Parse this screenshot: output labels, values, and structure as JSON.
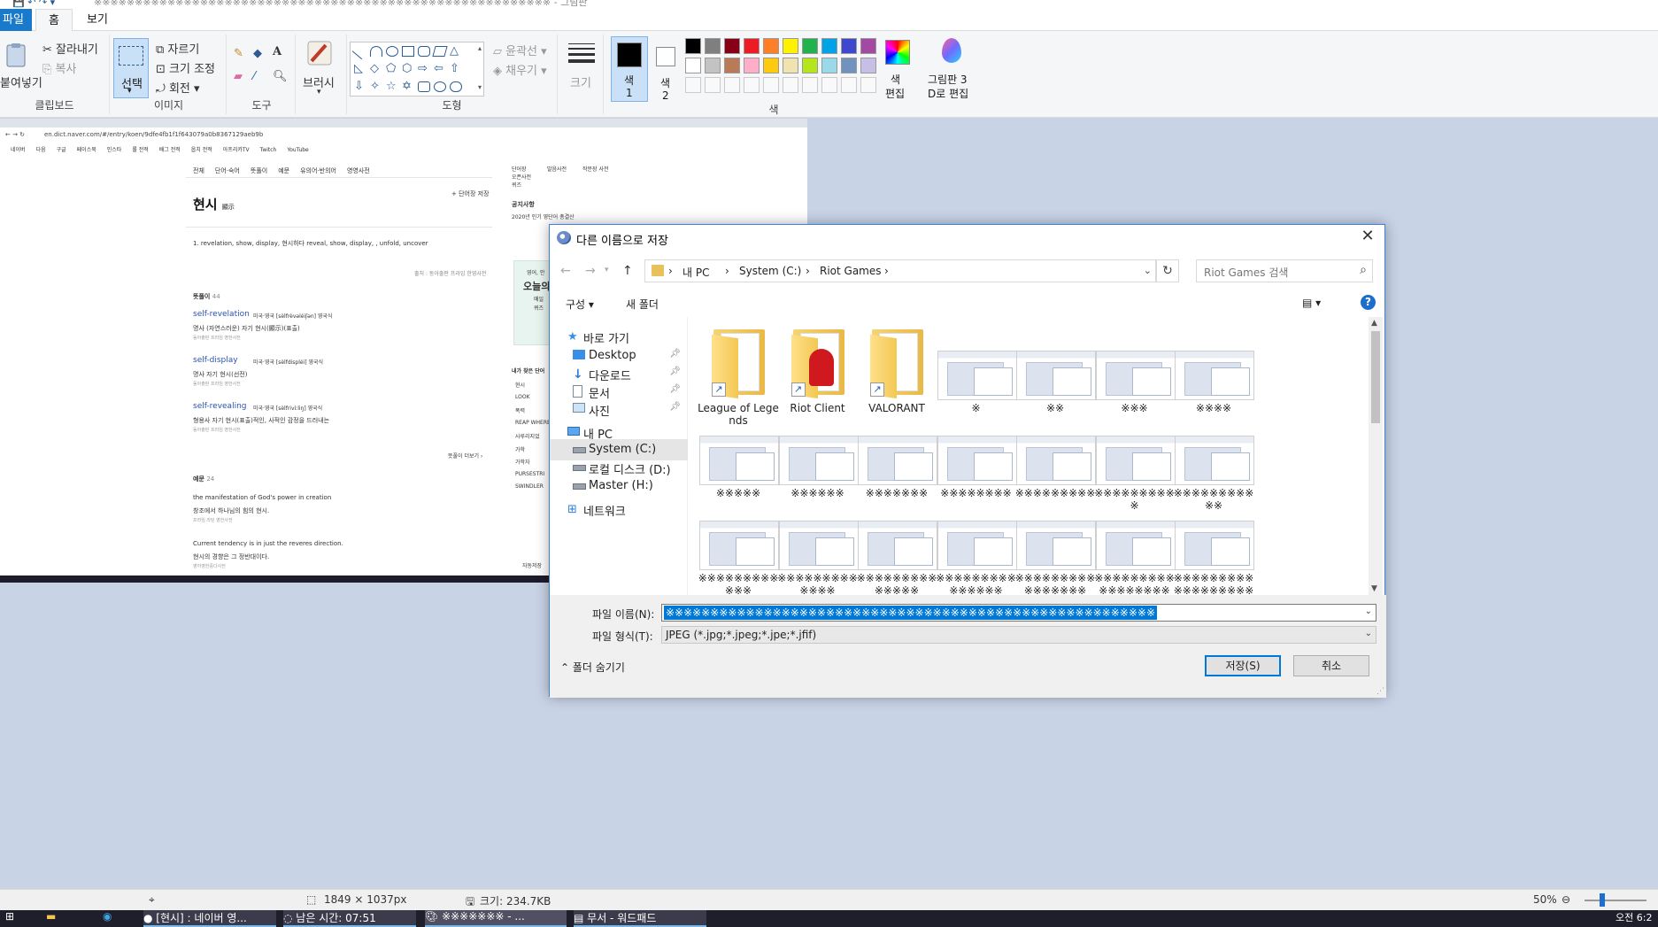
{
  "paint": {
    "title": "※※※※※※※※※※※※※※※※※※※※※※※※※※※※※※※※※※※※※※※※※※※※※※※※※※※※※※※※ - 그림판",
    "tabs": [
      "파일",
      "홈",
      "보기"
    ],
    "clipboard": {
      "paste": "붙여넣기",
      "cut": "잘라내기",
      "copy": "복사",
      "label": "클립보드"
    },
    "image": {
      "select": "선택",
      "crop": "자르기",
      "resize": "크기 조정",
      "rotate": "회전",
      "label": "이미지"
    },
    "tools": {
      "label": "도구"
    },
    "brushes": "브러시",
    "shapes": {
      "outline": "윤곽선",
      "fill": "채우기",
      "label": "도형"
    },
    "size": "크기",
    "color1": {
      "label": "색",
      "num": "1",
      "value": "#000000"
    },
    "color2": {
      "label": "색",
      "num": "2",
      "value": "#ffffff"
    },
    "colors_label": "색",
    "edit_colors": [
      "색",
      "편집"
    ],
    "paint3d": [
      "그림판 3",
      "D로 편집"
    ],
    "palette_row1": [
      "#000000",
      "#7f7f7f",
      "#880015",
      "#ed1c24",
      "#ff7f27",
      "#fff200",
      "#22b14c",
      "#00a2e8",
      "#3f48cc",
      "#a349a4"
    ],
    "palette_row2": [
      "#ffffff",
      "#c3c3c3",
      "#b97a57",
      "#ffaec9",
      "#ffc90e",
      "#efe4b0",
      "#b5e61d",
      "#99d9ea",
      "#7092be",
      "#c8bfe7"
    ]
  },
  "canvas": {
    "url": "en.dict.naver.com/#/entry/koen/9dfe4fb1f1f643079a0b8367129aeb9b",
    "bookmarks": [
      "네이버",
      "다음",
      "구글",
      "페이스북",
      "인스타",
      "롤 전적",
      "배그 전적",
      "옵치 전적",
      "아프리카TV",
      "Twitch",
      "YouTube"
    ],
    "nav_tabs": [
      "전체",
      "단어·숙어",
      "뜻풀이",
      "예문",
      "유의어·반의어",
      "영영사전"
    ],
    "word": "현시",
    "word_hanja": "顯示",
    "add_wordbook": "+ 단어장 저장",
    "meaning": "1.  revelation, show, display, 현시하다 reveal, show, display, , unfold, uncover",
    "source": "출처 : 동아출판 프라임 한영사전",
    "section_meanings": "뜻풀이",
    "section_meanings_count": "44",
    "entries": [
      {
        "word": "self-revelation",
        "pron": "미국·영국 [sèlfrèvəléiʃən]  영국식",
        "ko": "명사 (자연스러운) 자기 현시(顯示)(표출)",
        "src": "동아출판 프라임 영한사전"
      },
      {
        "word": "self-display",
        "pron": "미국·영국 [sèlfdispléi]  영국식",
        "ko": "명사 자기 현시(선전)",
        "src": "동아출판 프라임 영한사전"
      },
      {
        "word": "self-revealing",
        "pron": "미국·영국 [sèlfrivíːliŋ]  영국식",
        "ko": "형용사 자기 현시(표출)적인, 사적인 감정을 드러내는",
        "src": "동아출판 프라임 영한사전"
      }
    ],
    "more_meanings": "뜻풀이 더보기 ›",
    "section_examples": "예문",
    "section_examples_count": "24",
    "examples": [
      {
        "en": "the manifestation of God's power in creation",
        "ko": "창조에서 하나님의 힘의 현시.",
        "src": "프라임 라틴 영한사전"
      },
      {
        "en": "Current tendency is in just the reveres direction.",
        "ko": "현시의 경향은 그 정반대이다.",
        "src": "영어영한중다사전"
      }
    ],
    "side_tabs": [
      "단어장",
      "발음사전",
      "작문장 사전",
      "오픈사전",
      "퀴즈"
    ],
    "notice": "공지사항",
    "notice_text": "2020년 인기 영단어 총결산",
    "green_title": "영어, 안",
    "green_sub": "오늘의",
    "green_small": [
      "매일",
      "퀴즈"
    ],
    "recent_title": "내가 찾은 단어",
    "recent": [
      "현시",
      "LOOK",
      "폭력",
      "REAP WHERE",
      "사루리지었",
      "가학",
      "가학자",
      "PURSESTRI",
      "SWINDLER"
    ],
    "autocomplete": "자동저장"
  },
  "dialog": {
    "title": "다른 이름으로 저장",
    "path": [
      "내 PC",
      "System (C:)",
      "Riot Games"
    ],
    "search_placeholder": "Riot Games 검색",
    "organize": "구성 ▾",
    "new_folder": "새 폴더",
    "nav": [
      {
        "label": "바로 가기",
        "icon": "star-icon",
        "pin": false
      },
      {
        "label": "Desktop",
        "icon": "desktop-icon",
        "pin": true
      },
      {
        "label": "다운로드",
        "icon": "download-icon",
        "pin": true
      },
      {
        "label": "문서",
        "icon": "document-icon",
        "pin": true
      },
      {
        "label": "사진",
        "icon": "picture-icon",
        "pin": true
      },
      {
        "label": "내 PC",
        "icon": "pc-icon",
        "pin": false
      },
      {
        "label": "System (C:)",
        "icon": "drive-icon",
        "pin": false
      },
      {
        "label": "로컬 디스크 (D:)",
        "icon": "drive-icon",
        "pin": false
      },
      {
        "label": "Master (H:)",
        "icon": "drive-icon",
        "pin": false
      },
      {
        "label": "네트워크",
        "icon": "network-icon",
        "pin": false
      }
    ],
    "files": [
      {
        "name": "League of Legends",
        "kind": "folder"
      },
      {
        "name": "Riot Client",
        "kind": "riot"
      },
      {
        "name": "VALORANT",
        "kind": "folder"
      },
      {
        "name": "※",
        "kind": "img"
      },
      {
        "name": "※※",
        "kind": "img"
      },
      {
        "name": "※※※",
        "kind": "img"
      },
      {
        "name": "※※※※",
        "kind": "img"
      },
      {
        "name": "※※※※※",
        "kind": "img"
      },
      {
        "name": "※※※※※※",
        "kind": "img"
      },
      {
        "name": "※※※※※※※",
        "kind": "img"
      },
      {
        "name": "※※※※※※※※",
        "kind": "img"
      },
      {
        "name": "※※※※※※※※※",
        "kind": "img"
      },
      {
        "name": "※※※※※※※※※※",
        "kind": "img"
      },
      {
        "name": "※※※※※※※※※※※",
        "kind": "img"
      },
      {
        "name": "※※※※※※※※※※※※",
        "kind": "img"
      },
      {
        "name": "※※※※※※※※※※※※※",
        "kind": "img"
      },
      {
        "name": "※※※※※※※※※※※※※※",
        "kind": "img"
      },
      {
        "name": "※※※※※※※※※※※※※※※",
        "kind": "img"
      },
      {
        "name": "※※※※※※※※※※※※※※※※",
        "kind": "img"
      },
      {
        "name": "※※※※※※※※※※※※※※※※※",
        "kind": "img"
      },
      {
        "name": "※※※※※※※※※※※※※※※※※※",
        "kind": "img"
      }
    ],
    "filename_label": "파일 이름(N):",
    "filename_value": "※※※※※※※※※※※※※※※※※※※※※※※※※※※※※※※※※※※※※※※※※※※※※※※※※※※※※※※",
    "filetype_label": "파일 형식(T):",
    "filetype_value": "JPEG (*.jpg;*.jpeg;*.jpe;*.jfif)",
    "hide_folders": "폴더 숨기기",
    "save": "저장(S)",
    "cancel": "취소"
  },
  "status": {
    "dimensions": "1849 × 1037px",
    "size": "크기: 234.7KB",
    "zoom": "50%",
    "zoom_level": 0.5
  },
  "taskbar": {
    "apps": [
      "[현시] : 네이버 영...",
      "남은 시간: 07:51",
      "※※※※※※※ - ...",
      "무서 - 워드패드"
    ],
    "time": "오전 6:2"
  }
}
